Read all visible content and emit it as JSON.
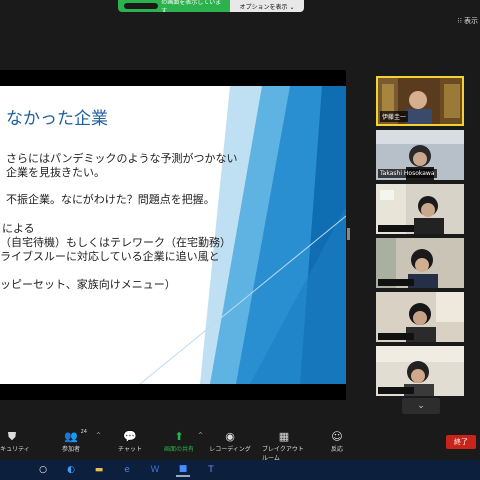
{
  "share_banner": {
    "text": "の画面を表示しています",
    "options_label": "オプションを表示 ⌄"
  },
  "view_button": {
    "label": "表示"
  },
  "slide": {
    "title": "なかった企業",
    "lines": [
      "さらにはパンデミックのような予測がつかない",
      "企業を見抜きたい。",
      "不振企業。なにがわけた？問題点を把握。",
      "による",
      "（自宅待機）もしくはテレワーク（在宅勤務）",
      "ライブスルーに対応している企業に追い風と",
      "ッピーセット、家族向けメニュー）"
    ]
  },
  "participants": [
    {
      "name": "伊藤圭一",
      "hidden": false,
      "active": true
    },
    {
      "name": "Takashi Hosokawa",
      "hidden": false,
      "active": false
    },
    {
      "name": "",
      "hidden": true,
      "active": false
    },
    {
      "name": "",
      "hidden": true,
      "active": false
    },
    {
      "name": "",
      "hidden": true,
      "active": false
    },
    {
      "name": "",
      "hidden": true,
      "active": false
    }
  ],
  "toolbar": {
    "security": "セキュリティ",
    "participants": "参加者",
    "participant_count": "24",
    "chat": "チャット",
    "share": "画面の共有",
    "record": "レコーディング",
    "breakout": "ブレイクアウトルーム",
    "reactions": "反応",
    "end": "終了"
  },
  "colors": {
    "share_green": "#2bb24c",
    "end_red": "#c8241c",
    "slide_title": "#1f5f9f",
    "active_border": "#f2d330"
  }
}
